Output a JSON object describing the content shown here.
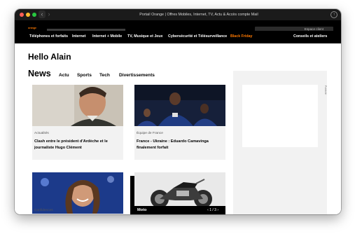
{
  "window": {
    "title": "Portail Orange | Offres Mobiles, Internet, TV, Actu & Accès compte Mail",
    "share_icon": "share-icon"
  },
  "header": {
    "logo_text": "orange",
    "account_button": "Espace client"
  },
  "menu": {
    "items": [
      "Téléphones et forfaits",
      "Internet",
      "Internet + Mobile",
      "TV, Musique et Jeux",
      "Cybersécurité et Télésurveillance",
      "Black Friday"
    ],
    "right_item": "Conseils et ateliers",
    "highlight_color": "#ff7900"
  },
  "page": {
    "greeting": "Hello Alain",
    "news_heading": "News",
    "tabs": [
      "Actu",
      "Sports",
      "Tech",
      "Divertissements"
    ]
  },
  "ad": {
    "label": "Publicité"
  },
  "cards": [
    {
      "category": "Actualités",
      "title": "Clash entre le président d'Ardèche et le journaliste Hugo Clément"
    },
    {
      "category": "Équipe de France",
      "title": "France - Ukraine : Eduardo Camavinga finalement forfait"
    },
    {
      "category": "Confidences",
      "title": ""
    },
    {
      "category": "Moto",
      "pager": "1 / 3"
    }
  ]
}
